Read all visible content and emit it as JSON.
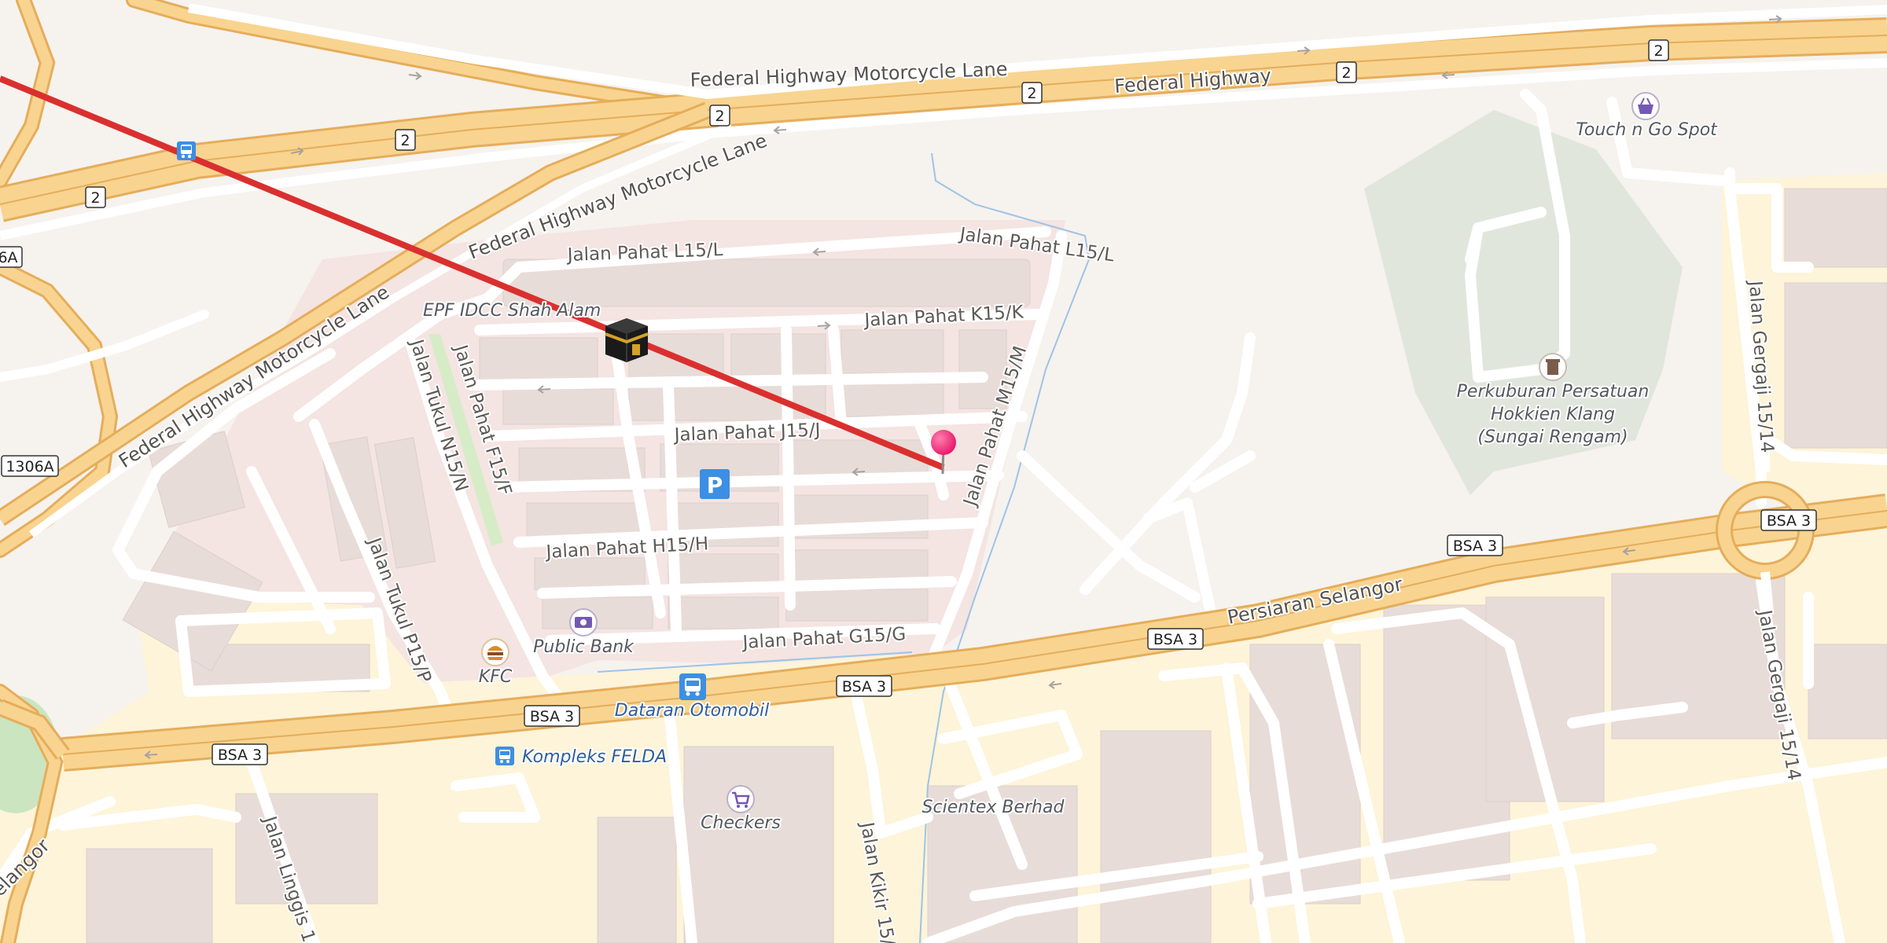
{
  "map": {
    "highways": {
      "federal_highway": "Federal Highway",
      "federal_moto_1": "Federal Highway Motorcycle Lane",
      "federal_moto_2": "Federal Highway Motorcycle Lane",
      "federal_moto_3": "Federal Highway Motorcycle Lane",
      "persiaran_selangor": "Persiaran Selangor",
      "selangor_cut": "elangor"
    },
    "route_shields": {
      "r2": "2",
      "bsa3": "BSA 3",
      "r1306a": "1306A",
      "r6a": "6A"
    },
    "streets": {
      "pahat_l15l_h": "Jalan Pahat L15/L",
      "pahat_l15l_v": "Jalan Pahat L15/L",
      "pahat_k15k": "Jalan Pahat K15/K",
      "pahat_j15j": "Jalan Pahat J15/J",
      "pahat_h15h": "Jalan Pahat H15/H",
      "pahat_g15g": "Jalan Pahat G15/G",
      "pahat_m15m": "Jalan Pahat M15/M",
      "pahat_f15f": "Jalan Pahat F15/F",
      "tukul_n15n": "Jalan Tukul N15/N",
      "tukul_p15p": "Jalan Tukul P15/P",
      "gergaji_1514_a": "Jalan Gergaji 15/14",
      "gergaji_1514_b": "Jalan Gergaji 15/14",
      "linggis": "Jalan Linggis 1",
      "kikir": "Jalan Kikir 15/"
    },
    "pois": {
      "epf": "EPF IDCC Shah Alam",
      "touch_n_go": "Touch n Go Spot",
      "cemetery_1": "Perkuburan Persatuan",
      "cemetery_2": "Hokkien Klang",
      "cemetery_3": "(Sungai Rengam)",
      "public_bank": "Public Bank",
      "kfc": "KFC",
      "dataran_otomobil": "Dataran Otomobil",
      "kompleks_felda": "Kompleks FELDA",
      "checkers": "Checkers",
      "scientex": "Scientex Berhad"
    },
    "icons": [
      "kaaba-icon",
      "location-pin-icon",
      "parking-icon",
      "bus-stop-icon",
      "bank-icon",
      "fastfood-icon",
      "shopping-basket-icon",
      "shopping-cart-icon",
      "grave-icon"
    ],
    "colors": {
      "background": "#f6f2ee",
      "motorway": "#f8d490",
      "motorway_casing": "#e5ad5b",
      "minor_road": "#ffffff",
      "residential_area": "#f4e4e2",
      "commercial_area": "#fdf4d9",
      "cemetery": "#e1e6dd",
      "water": "#9ec3e6",
      "qibla_line": "#d9302f",
      "pin": "#e8166b",
      "parking": "#3d8fe3"
    }
  }
}
